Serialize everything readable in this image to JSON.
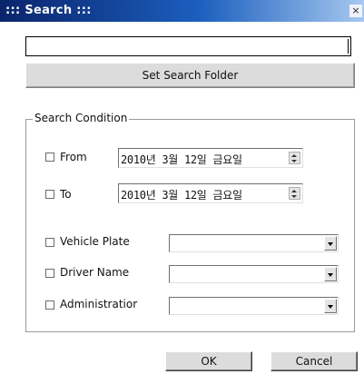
{
  "window": {
    "title": "::: Search :::",
    "close_glyph": "×"
  },
  "search": {
    "value": "",
    "set_folder_label": "Set Search Folder"
  },
  "condition": {
    "group_label": "Search Condition",
    "from": {
      "label": "From",
      "checked": false,
      "value": "2010년  3월 12일 금요일"
    },
    "to": {
      "label": "To",
      "checked": false,
      "value": "2010년  3월 12일 금요일"
    },
    "vehicle_plate": {
      "label": "Vehicle Plate",
      "checked": false,
      "value": ""
    },
    "driver_name": {
      "label": "Driver Name",
      "checked": false,
      "value": ""
    },
    "administrator": {
      "label": "Administratior",
      "checked": false,
      "value": ""
    }
  },
  "buttons": {
    "ok": "OK",
    "cancel": "Cancel"
  },
  "icons": {
    "close": "close-icon",
    "spin": "spin-updown-icon",
    "combo": "chevron-down-icon"
  }
}
